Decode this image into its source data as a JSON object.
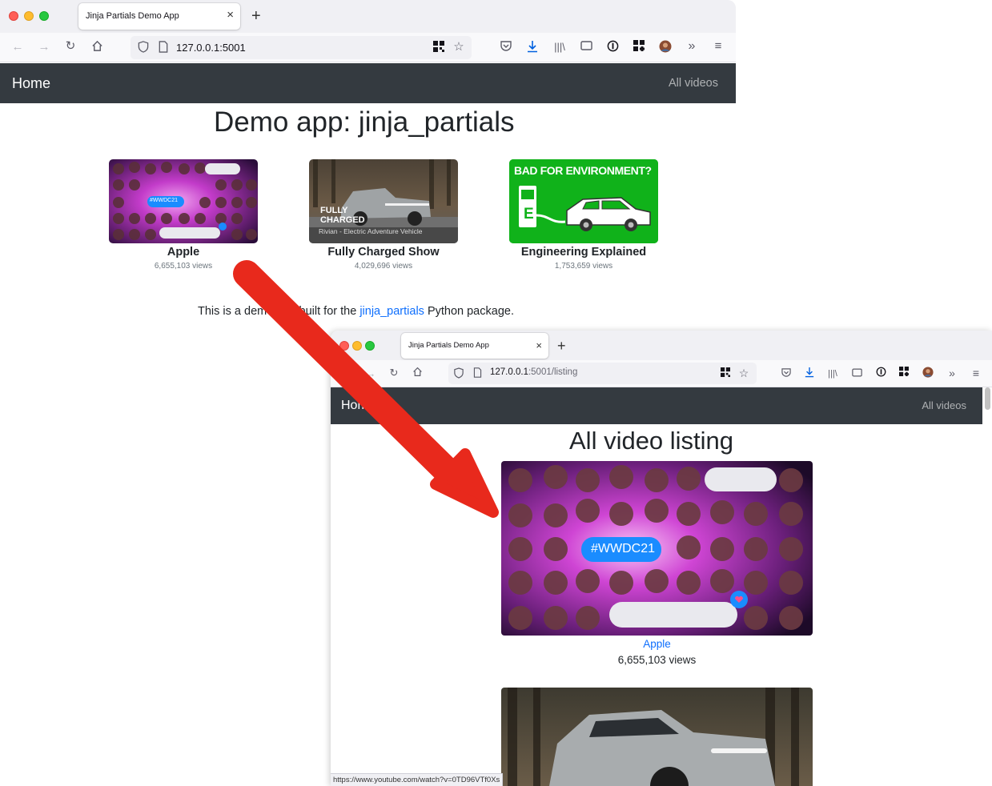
{
  "window1": {
    "tab_title": "Jinja Partials Demo App",
    "tab_close": "×",
    "new_tab": "+",
    "url_host": "127.0.0.1:5001",
    "url_path": "",
    "site_brand": "Home",
    "site_nav_link": "All videos",
    "page_title": "Demo app: jinja_partials",
    "videos": [
      {
        "title": "Apple",
        "views": "6,655,103 views"
      },
      {
        "title": "Fully Charged Show",
        "views": "4,029,696 views",
        "thumb_overlay": [
          "FULLY",
          "CHARGED"
        ],
        "thumb_caption": "Rivian - Electric Adventure Vehicle"
      },
      {
        "title": "Engineering Explained",
        "views": "1,753,659 views",
        "thumb_overlay": [
          "BAD FOR ENVIRONMENT?"
        ],
        "thumb_letter": "E"
      }
    ],
    "intro": {
      "before": "This is a demo app built for the ",
      "link": "jinja_partials",
      "after": " Python package."
    }
  },
  "window2": {
    "tab_title": "Jinja Partials Demo App",
    "tab_close": "×",
    "new_tab": "+",
    "url_host": "127.0.0.1",
    "url_path": ":5001/listing",
    "site_brand": "Home",
    "site_nav_link": "All videos",
    "page_title": "All video listing",
    "videos": [
      {
        "title": "Apple",
        "views": "6,655,103 views",
        "hashtag": "#WWDC21"
      }
    ],
    "status_url": "https://www.youtube.com/watch?v=0TD96VTf0Xs"
  },
  "thumb_texts": {
    "wwdc_small": "#WWDC21"
  },
  "colors": {
    "navbar_bg": "#343a40",
    "link": "#0d6efd",
    "arrow": "#e8291c",
    "engineering_bg": "#10b21a"
  },
  "icons": {
    "back": "arrow-left-icon",
    "forward": "arrow-right-icon",
    "reload": "reload-icon",
    "home": "home-icon",
    "shield": "shield-icon",
    "page": "page-icon",
    "qr": "qr-grid-icon",
    "bookmark": "star-icon",
    "pocket": "pocket-icon",
    "download": "download-icon",
    "library": "library-icon",
    "sidebar": "sidebar-icon",
    "info": "info-icon",
    "extensions": "extensions-icon",
    "profile": "avatar",
    "overflow": "chevron-double-right-icon",
    "menu": "hamburger-menu-icon"
  }
}
